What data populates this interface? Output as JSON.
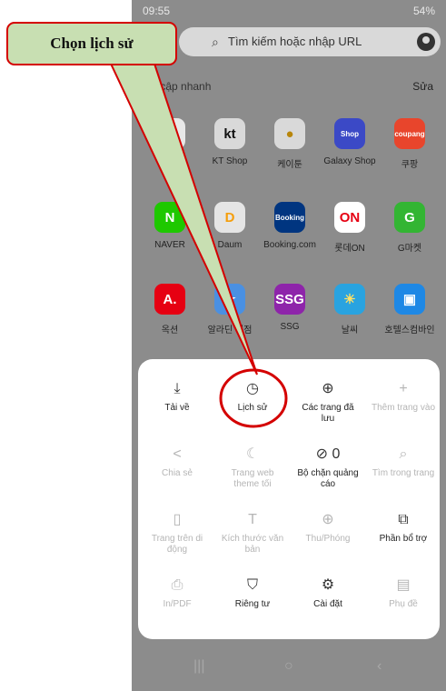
{
  "status_bar": {
    "time": "09:55",
    "battery": "54%"
  },
  "search": {
    "placeholder": "Tìm kiếm hoặc nhập URL",
    "icon": "search-icon"
  },
  "quick_access": {
    "title": "Truy cập nhanh",
    "title_visible": "y cập nhanh",
    "edit_label": "Sửa",
    "rows": [
      [
        {
          "label": "",
          "tile_text": "G",
          "color": "#e8e8e8",
          "text_color": "#4285f4"
        },
        {
          "label": "KT Shop",
          "tile_text": "kt",
          "color": "#d9d9d9",
          "text_color": "#111111"
        },
        {
          "label": "케이툰",
          "tile_text": "●",
          "color": "#d9d9d9",
          "text_color": "#b8860b"
        },
        {
          "label": "Galaxy Shop",
          "tile_text": "Shop",
          "color": "#3b49c6",
          "text_color": "#ffffff"
        },
        {
          "label": "쿠팡",
          "tile_text": "coupang",
          "color": "#e8452c",
          "text_color": "#ffffff"
        }
      ],
      [
        {
          "label": "NAVER",
          "tile_text": "N",
          "color": "#1ec800",
          "text_color": "#ffffff"
        },
        {
          "label": "Daum",
          "tile_text": "D",
          "color": "#e5e5e5",
          "text_color": "#f59e0b"
        },
        {
          "label": "Booking.com",
          "tile_text": "Booking",
          "color": "#003580",
          "text_color": "#ffffff"
        },
        {
          "label": "롯데ON",
          "tile_text": "ON",
          "color": "#ffffff",
          "text_color": "#e60012"
        },
        {
          "label": "G마켓",
          "tile_text": "G",
          "color": "#33b533",
          "text_color": "#ffffff"
        }
      ],
      [
        {
          "label": "옥션",
          "tile_text": "A.",
          "color": "#e60012",
          "text_color": "#ffffff"
        },
        {
          "label": "알라딘 서점",
          "tile_text": "★",
          "color": "#4a90e2",
          "text_color": "#ffffff"
        },
        {
          "label": "SSG",
          "tile_text": "SSG",
          "color": "#8e24aa",
          "text_color": "#ffffff"
        },
        {
          "label": "날씨",
          "tile_text": "☀",
          "color": "#29a3e0",
          "text_color": "#ffe066"
        },
        {
          "label": "호텔스컴바인",
          "tile_text": "▣",
          "color": "#1e88e5",
          "text_color": "#ffffff"
        }
      ]
    ]
  },
  "menu": {
    "rows": [
      [
        {
          "name": "download",
          "icon": "download-icon",
          "glyph": "⤓",
          "label": "Tải về",
          "enabled": true
        },
        {
          "name": "history",
          "icon": "clock-icon",
          "glyph": "◷",
          "label": "Lịch sử",
          "enabled": true
        },
        {
          "name": "saved-pages",
          "icon": "globe-save-icon",
          "glyph": "⊕",
          "label": "Các trang đã lưu",
          "enabled": true
        },
        {
          "name": "add-page",
          "icon": "plus-icon",
          "glyph": "+",
          "label": "Thêm trang vào",
          "enabled": false
        }
      ],
      [
        {
          "name": "share",
          "icon": "share-icon",
          "glyph": "<",
          "label": "Chia sẻ",
          "enabled": false
        },
        {
          "name": "dark-theme",
          "icon": "moon-icon",
          "glyph": "☾",
          "label": "Trang web theme tối",
          "enabled": false
        },
        {
          "name": "ad-blocker",
          "icon": "block-icon",
          "glyph": "⊘ 0",
          "label": "Bộ chặn quảng cáo",
          "enabled": true
        },
        {
          "name": "find-in-page",
          "icon": "find-icon",
          "glyph": "⌕",
          "label": "Tìm trong trang",
          "enabled": false
        }
      ],
      [
        {
          "name": "mobile-page",
          "icon": "phone-icon",
          "glyph": "▯",
          "label": "Trang trên di động",
          "enabled": false
        },
        {
          "name": "text-size",
          "icon": "text-size-icon",
          "glyph": "T",
          "label": "Kích thước văn bản",
          "enabled": false
        },
        {
          "name": "zoom",
          "icon": "zoom-icon",
          "glyph": "⊕",
          "label": "Thu/Phóng",
          "enabled": false
        },
        {
          "name": "add-ons",
          "icon": "puzzle-icon",
          "glyph": "⧉",
          "label": "Phần bổ trợ",
          "enabled": true
        }
      ],
      [
        {
          "name": "print-pdf",
          "icon": "print-icon",
          "glyph": "⎙",
          "label": "In/PDF",
          "enabled": false
        },
        {
          "name": "privacy",
          "icon": "shield-icon",
          "glyph": "⛉",
          "label": "Riêng tư",
          "enabled": true
        },
        {
          "name": "settings",
          "icon": "gear-icon",
          "glyph": "⚙",
          "label": "Cài đặt",
          "enabled": true
        },
        {
          "name": "subtitles",
          "icon": "subtitle-icon",
          "glyph": "▤",
          "label": "Phụ đề",
          "enabled": false
        }
      ]
    ]
  },
  "annotation": {
    "callout_text": "Chọn lịch sử",
    "color": "#d40000",
    "fill": "#c8dfb2"
  },
  "nav": {
    "recents": "|||",
    "home": "○",
    "back": "‹"
  }
}
